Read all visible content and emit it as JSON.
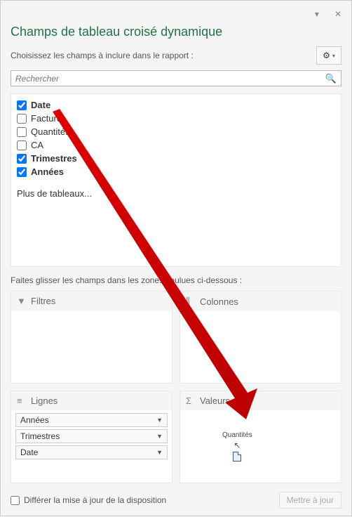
{
  "titlebar": {
    "dropdown_glyph": "▾",
    "close_glyph": "✕"
  },
  "title": "Champs de tableau croisé dynamique",
  "instruction": "Choisissez les champs à inclure dans le rapport :",
  "gear": {
    "icon": "⚙",
    "caret": "▾"
  },
  "search": {
    "placeholder": "Rechercher",
    "icon": "🔍"
  },
  "fields": [
    {
      "label": "Date",
      "checked": true,
      "bold": true
    },
    {
      "label": "Facture",
      "checked": false,
      "bold": false
    },
    {
      "label": "Quantités",
      "checked": false,
      "bold": false
    },
    {
      "label": "CA",
      "checked": false,
      "bold": false
    },
    {
      "label": "Trimestres",
      "checked": true,
      "bold": true
    },
    {
      "label": "Années",
      "checked": true,
      "bold": true
    }
  ],
  "more_tables": "Plus de tableaux...",
  "drag_instruction": "Faites glisser les champs dans les zones voulues ci-dessous :",
  "zones": {
    "filters": {
      "title": "Filtres",
      "icon": "▼"
    },
    "columns": {
      "title": "Colonnes",
      "icon": "⫼"
    },
    "rows": {
      "title": "Lignes",
      "icon": "≡",
      "items": [
        "Années",
        "Trimestres",
        "Date"
      ]
    },
    "values": {
      "title": "Valeurs",
      "icon": "Σ",
      "ghost_label": "Quantités"
    }
  },
  "footer": {
    "defer_label": "Différer la mise à jour de la disposition",
    "update_label": "Mettre à jour"
  },
  "colors": {
    "accent": "#217346"
  }
}
